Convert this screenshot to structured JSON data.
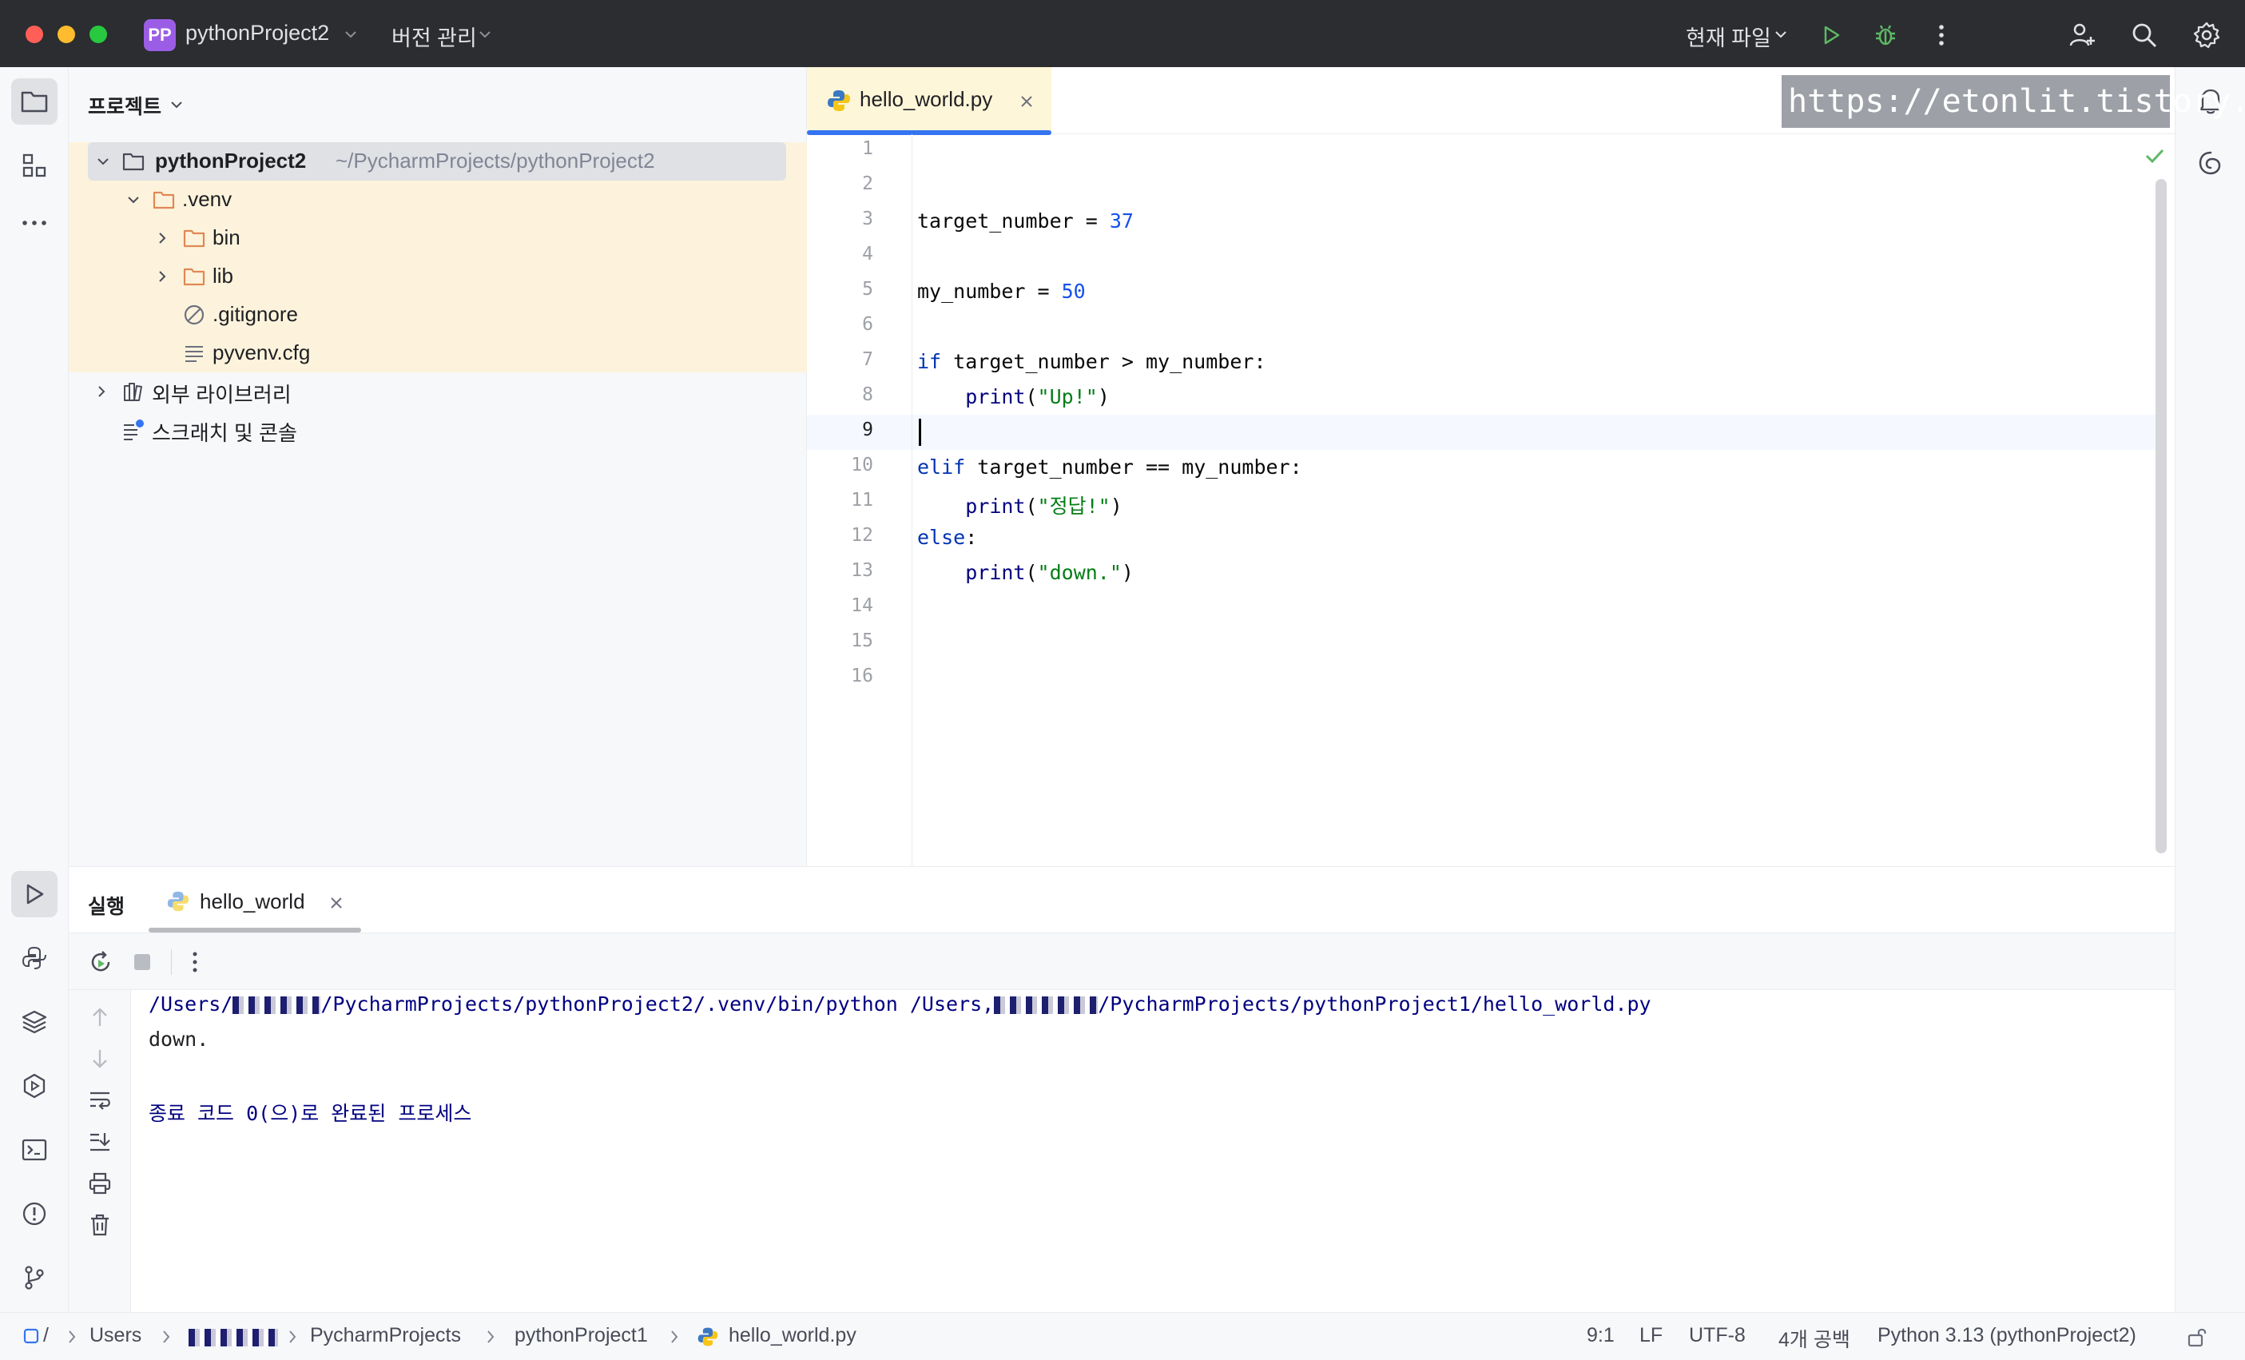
{
  "titlebar": {
    "project_badge": "PP",
    "project_name": "pythonProject2",
    "vcs_label": "버전 관리",
    "run_config": "현재 파일"
  },
  "project_panel": {
    "title": "프로젝트",
    "tree": [
      {
        "label": "pythonProject2",
        "sub": "~/PycharmProjects/pythonProject2"
      },
      {
        "label": ".venv"
      },
      {
        "label": "bin"
      },
      {
        "label": "lib"
      },
      {
        "label": ".gitignore"
      },
      {
        "label": "pyvenv.cfg"
      },
      {
        "label": "외부 라이브러리"
      },
      {
        "label": "스크래치 및 콘솔"
      }
    ]
  },
  "editor": {
    "tab_label": "hello_world.py",
    "watermark": "https://etonlit.tistory.com",
    "line_numbers": [
      "1",
      "2",
      "3",
      "4",
      "5",
      "6",
      "7",
      "8",
      "9",
      "10",
      "11",
      "12",
      "13",
      "14",
      "15",
      "16"
    ],
    "current_line": 9,
    "code": {
      "l3_name": "target_number",
      "l3_op": " = ",
      "l3_val": "37",
      "l5_name": "my_number",
      "l5_op": " = ",
      "l5_val": "50",
      "l7_kw": "if",
      "l7_rest": " target_number > my_number:",
      "l8_indent": "    ",
      "l8_fn": "print",
      "l8_open": "(",
      "l8_str": "\"Up!\"",
      "l8_close": ")",
      "l10_kw": "elif",
      "l10_rest": " target_number == my_number:",
      "l11_indent": "    ",
      "l11_fn": "print",
      "l11_open": "(",
      "l11_str": "\"정답!\"",
      "l11_close": ")",
      "l12_kw": "else",
      "l12_rest": ":",
      "l13_indent": "    ",
      "l13_fn": "print",
      "l13_open": "(",
      "l13_str": "\"down.\"",
      "l13_close": ")"
    }
  },
  "run_panel": {
    "title": "실행",
    "tab_label": "hello_world",
    "console": {
      "cmd_part1": "/Users/",
      "cmd_part2": "/PycharmProjects/pythonProject2/.venv/bin/python /Users,",
      "cmd_part3": "/PycharmProjects/pythonProject1/hello_world.py",
      "output": "down.",
      "exit_message": "종료 코드 0(으)로 완료된 프로세스"
    }
  },
  "statusbar": {
    "root_label": "/",
    "crumbs": [
      "Users",
      "PycharmProjects",
      "pythonProject1",
      "hello_world.py"
    ],
    "position": "9:1",
    "line_sep": "LF",
    "encoding": "UTF-8",
    "indent": "4개 공백",
    "interpreter": "Python 3.13 (pythonProject2)"
  },
  "colors": {
    "accent": "#3574f0",
    "keyword": "#0033b3",
    "number": "#1750eb",
    "string": "#067d17",
    "run_green": "#5fb865",
    "folder_orange": "#e08855"
  }
}
